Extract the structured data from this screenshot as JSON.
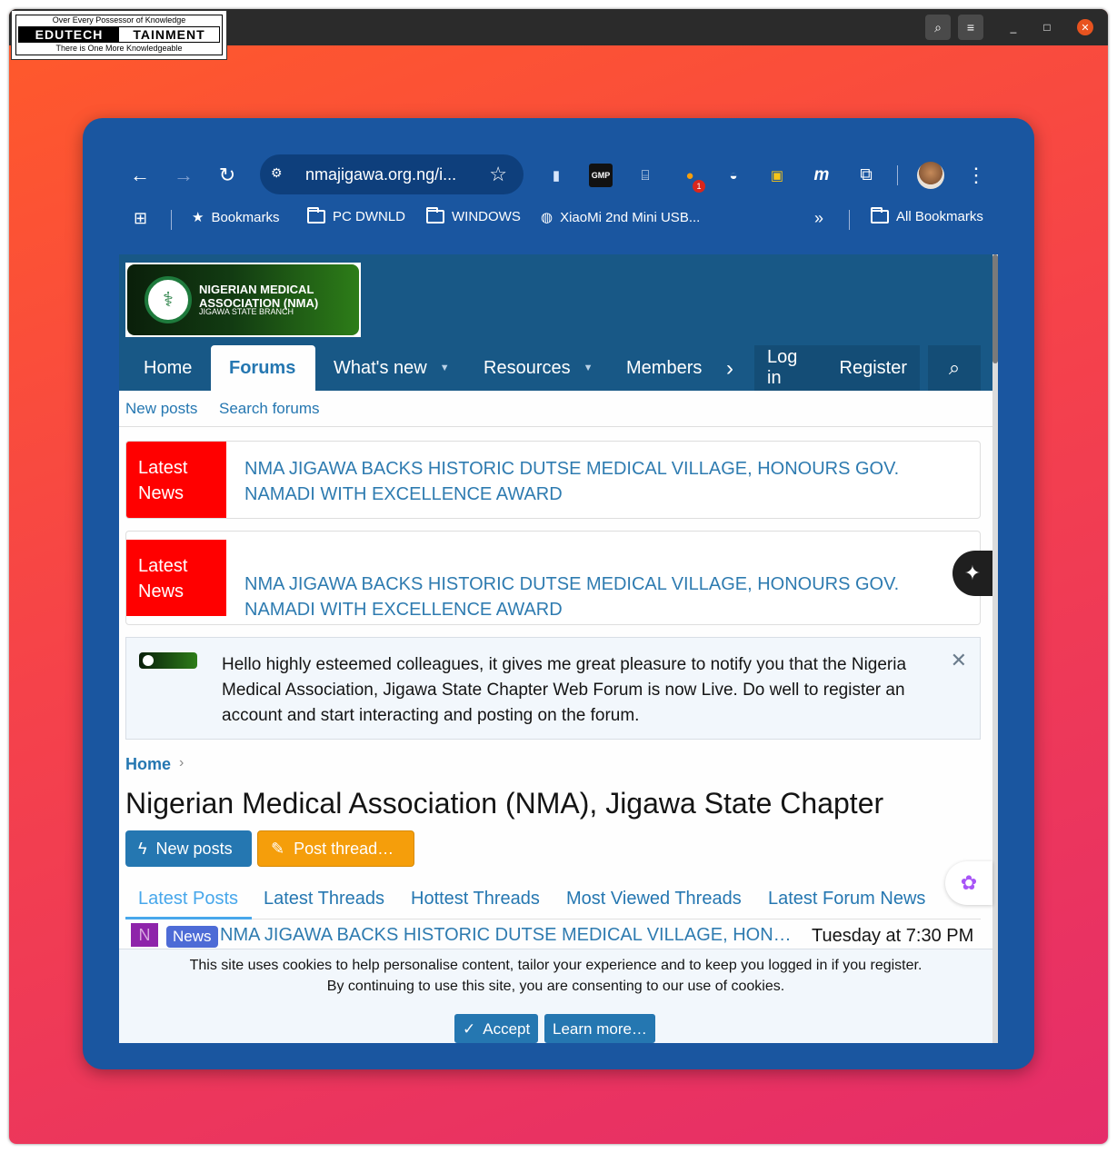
{
  "outer": {
    "logo_top": "Over Every Possessor of Knowledge",
    "logo_left": "EDUTECH",
    "logo_right": "TAINMENT",
    "logo_bottom": "There is One More Knowledgeable",
    "controls": {
      "minimize": "_",
      "maximize": "□",
      "close": "✕"
    }
  },
  "browser": {
    "url": "nmajigawa.org.ng/i...",
    "gmp_label": "GMP",
    "ext_badge": "1",
    "bookmarks": [
      {
        "label": "Bookmarks",
        "icon": "star-icon"
      },
      {
        "label": "PC DWNLD",
        "icon": "folder-icon"
      },
      {
        "label": "WINDOWS",
        "icon": "folder-icon"
      },
      {
        "label": "XiaoMi 2nd Mini USB...",
        "icon": "globe-icon"
      },
      {
        "label": "All Bookmarks",
        "icon": "folder-icon"
      }
    ],
    "overflow": "»"
  },
  "site": {
    "logo_line1": "NIGERIAN MEDICAL",
    "logo_line2": "ASSOCIATION (NMA)",
    "logo_line3": "JIGAWA STATE BRANCH",
    "nav": [
      "Home",
      "Forums",
      "What's new",
      "Resources",
      "Members"
    ],
    "nav_active": "Forums",
    "login": "Log in",
    "register": "Register",
    "subnav": [
      "New posts",
      "Search forums"
    ],
    "news": [
      {
        "label": "Latest News",
        "text": "NMA JIGAWA BACKS HISTORIC DUTSE MEDICAL VILLAGE, HONOURS GOV. NAMADI WITH EXCELLENCE AWARD"
      },
      {
        "label": "Latest News",
        "text": "NMA JIGAWA BACKS HISTORIC DUTSE MEDICAL VILLAGE, HONOURS GOV. NAMADI WITH EXCELLENCE AWARD"
      }
    ],
    "notice": "Hello highly esteemed colleagues, it gives me great pleasure to notify you that the Nigeria Medical Association, Jigawa State Chapter Web Forum is now Live. Do well to register an account and start interacting and posting on the forum.",
    "breadcrumb": "Home",
    "title": "Nigerian Medical Association (NMA), Jigawa State Chapter",
    "btn_new_posts": "New posts",
    "btn_post_thread": "Post thread…",
    "tabs": [
      "Latest Posts",
      "Latest Threads",
      "Hottest Threads",
      "Most Viewed Threads",
      "Latest Forum News"
    ],
    "post": {
      "avatar": "N",
      "label": "News",
      "title": "NMA JIGAWA BACKS HISTORIC DUTSE MEDICAL VILLAGE, HON…",
      "time": "Tuesday at 7:30 PM"
    },
    "cookie_line1": "This site uses cookies to help personalise content, tailor your experience and to keep you logged in if you register.",
    "cookie_line2": "By continuing to use this site, you are consenting to our use of cookies.",
    "accept": "Accept",
    "learn_more": "Learn more…"
  }
}
